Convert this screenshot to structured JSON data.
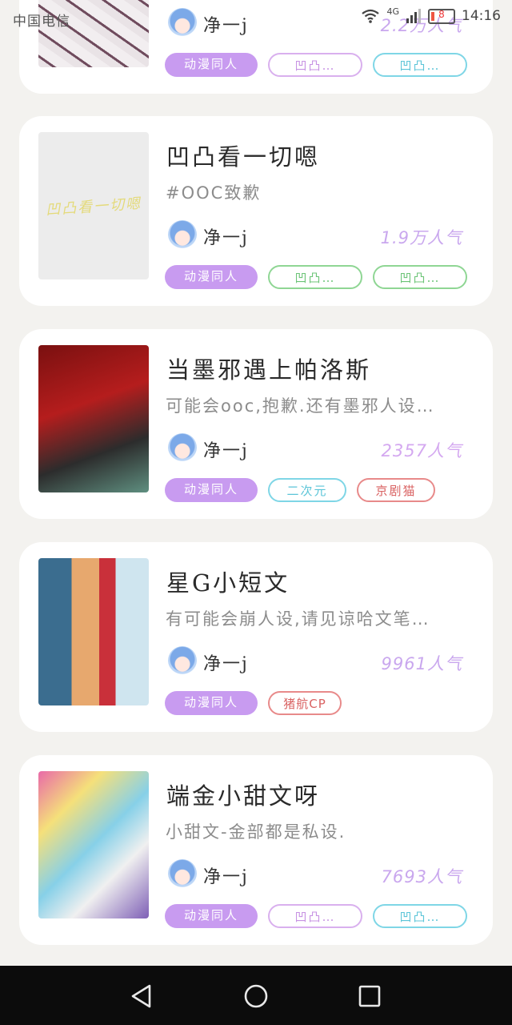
{
  "status_bar": {
    "carrier": "中国电信",
    "network": "4G",
    "battery": "8",
    "time": "14:16",
    "icons": [
      "wifi-icon",
      "signal-icon",
      "battery-icon"
    ]
  },
  "colors": {
    "main_tag": "#c89bf0",
    "popularity": "#c9a7ee",
    "tag_purple": "#cf9ae8",
    "tag_green": "#7ccf86",
    "tag_cyan": "#73d3e4",
    "tag_red": "#e06a6a"
  },
  "cards": [
    {
      "title": "",
      "description": "",
      "author": "净一j",
      "popularity": "2.2万人气",
      "tags": [
        {
          "label": "动漫同人",
          "style": "main"
        },
        {
          "label": "凹凸…",
          "style": "purple"
        },
        {
          "label": "凹凸…",
          "style": "cyan"
        }
      ]
    },
    {
      "title": "凹凸看一切嗯",
      "description": "#OOC致歉",
      "cover_text": "凹凸看一切嗯",
      "author": "净一j",
      "popularity": "1.9万人气",
      "tags": [
        {
          "label": "动漫同人",
          "style": "main"
        },
        {
          "label": "凹凸…",
          "style": "green"
        },
        {
          "label": "凹凸…",
          "style": "green"
        }
      ]
    },
    {
      "title": "当墨邪遇上帕洛斯",
      "description": "可能会ooc,抱歉.还有墨邪人设…",
      "author": "净一j",
      "popularity": "2357人气",
      "tags": [
        {
          "label": "动漫同人",
          "style": "main"
        },
        {
          "label": "二次元",
          "style": "cyan"
        },
        {
          "label": "京剧猫",
          "style": "red"
        }
      ]
    },
    {
      "title": "星G小短文",
      "description": "有可能会崩人设,请见谅哈文笔…",
      "author": "净一j",
      "popularity": "9961人气",
      "tags": [
        {
          "label": "动漫同人",
          "style": "main"
        },
        {
          "label": "猪航CP",
          "style": "red"
        }
      ]
    },
    {
      "title": "端金小甜文呀",
      "description": "小甜文-金部都是私设.",
      "author": "净一j",
      "popularity": "7693人气",
      "tags": [
        {
          "label": "动漫同人",
          "style": "main"
        },
        {
          "label": "凹凸…",
          "style": "purple"
        },
        {
          "label": "凹凸…",
          "style": "cyan"
        }
      ]
    }
  ],
  "navigation": {
    "back": "back-icon",
    "home": "home-icon",
    "recent": "recent-apps-icon"
  }
}
